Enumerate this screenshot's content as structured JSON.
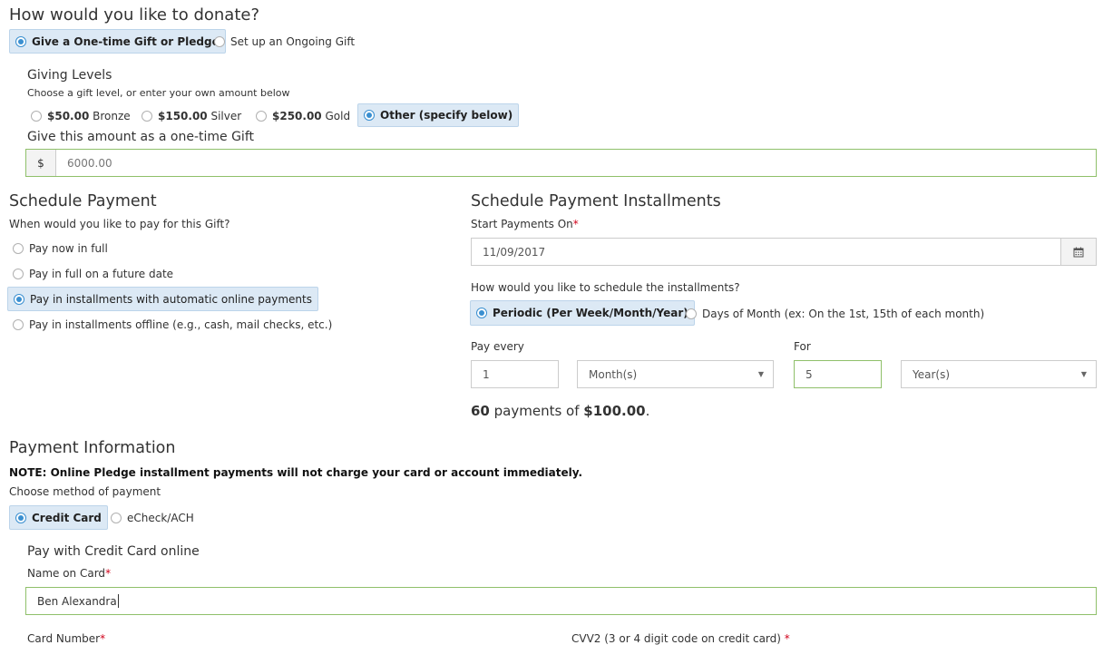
{
  "donate": {
    "title": "How would you like to donate?",
    "options": [
      {
        "label": "Give a One-time Gift or Pledge",
        "selected": true
      },
      {
        "label": "Set up an Ongoing Gift",
        "selected": false
      }
    ]
  },
  "giving_levels": {
    "title": "Giving Levels",
    "hint": "Choose a gift level, or enter your own amount below",
    "levels": [
      {
        "amount": "$50.00",
        "name": "Bronze",
        "selected": false
      },
      {
        "amount": "$150.00",
        "name": "Silver",
        "selected": false
      },
      {
        "amount": "$250.00",
        "name": "Gold",
        "selected": false
      },
      {
        "amount": "Other (specify below)",
        "name": "",
        "selected": true
      }
    ],
    "amount_label": "Give this amount as a one-time Gift",
    "currency_symbol": "$",
    "amount_value": "6000.00"
  },
  "schedule": {
    "title": "Schedule Payment",
    "question": "When would you like to pay for this Gift?",
    "options": [
      {
        "label": "Pay now in full",
        "selected": false
      },
      {
        "label": "Pay in full on a future date",
        "selected": false
      },
      {
        "label": "Pay in installments with automatic online payments",
        "selected": true
      },
      {
        "label": "Pay in installments offline (e.g., cash, mail checks, etc.)",
        "selected": false
      }
    ]
  },
  "installments": {
    "title": "Schedule Payment Installments",
    "start_label": "Start Payments On",
    "required_mark": "*",
    "start_date": "11/09/2017",
    "schedule_question": "How would you like to schedule the installments?",
    "modes": [
      {
        "label": "Periodic (Per Week/Month/Year)",
        "selected": true
      },
      {
        "label": "Days of Month (ex: On the 1st, 15th of each month)",
        "selected": false
      }
    ],
    "pay_every_label": "Pay every",
    "pay_every_value": "1",
    "period_unit": "Month(s)",
    "for_label": "For",
    "for_value": "5",
    "for_unit": "Year(s)",
    "summary_count": "60",
    "summary_text": " payments of ",
    "summary_amount": "$100.00",
    "summary_end": "."
  },
  "payment": {
    "title": "Payment Information",
    "note": "NOTE: Online Pledge installment payments will not charge your card or account immediately.",
    "method_label": "Choose method of payment",
    "methods": [
      {
        "label": "Credit Card",
        "selected": true
      },
      {
        "label": "eCheck/ACH",
        "selected": false
      }
    ],
    "cc_title": "Pay with Credit Card online",
    "name_label": "Name on Card",
    "name_value": "Ben Alexandra",
    "card_number_label": "Card Number",
    "cvv_label": "CVV2 (3 or 4 digit code on credit card)"
  },
  "colors": {
    "selected_bg": "#dce9f5",
    "radio_accent": "#3a8fd0",
    "valid_border": "#8fc06a",
    "required": "#d0021b"
  }
}
